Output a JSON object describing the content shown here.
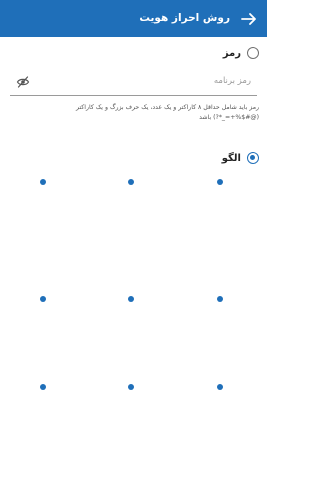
{
  "app_bar": {
    "title": "روش احراز هویت",
    "back_icon": "arrow-right-icon",
    "color": "#1f6fb9"
  },
  "password_option": {
    "label": "رمز",
    "selected": false,
    "field_placeholder": "رمز برنامه",
    "field_value": "",
    "visibility_icon": "eye-off-icon",
    "hint_line1": "رمز باید شامل حداقل ۸ کاراکتر و یک عدد، یک حرف بزرگ و یک کاراکتر",
    "hint_line2": "(@#$%+=_*?) باشد"
  },
  "pattern_option": {
    "label": "الگو",
    "selected": true,
    "grid_rows": 3,
    "grid_cols": 3
  }
}
